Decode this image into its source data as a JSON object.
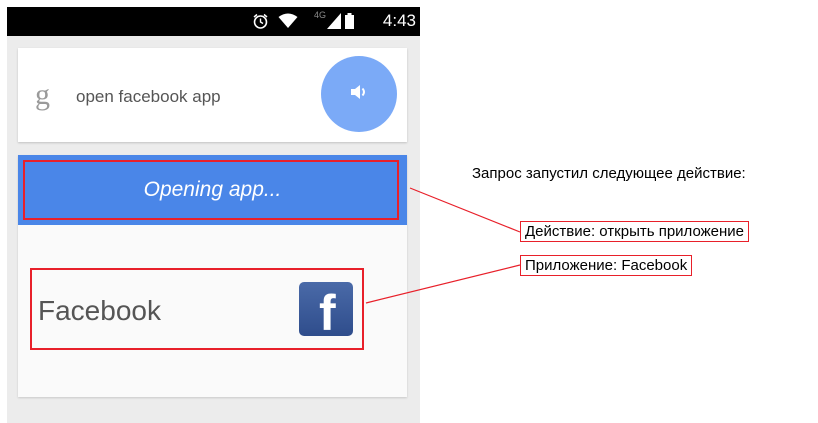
{
  "status_bar": {
    "network": "4G",
    "time": "4:43"
  },
  "search": {
    "query": "open facebook app",
    "google_logo": "g"
  },
  "action": {
    "status_text": "Opening app...",
    "app_name": "Facebook",
    "app_icon_letter": "f"
  },
  "annotations": {
    "heading": "Запрос запустил следующее действие:",
    "action_label": "Действие: открыть приложение",
    "app_label": "Приложение: Facebook"
  },
  "colors": {
    "accent_blue": "#4a86e8",
    "mic_blue": "#7baaf7",
    "highlight_red": "#e8202a",
    "facebook_blue": "#3b5998"
  },
  "icons": [
    "alarm-icon",
    "wifi-icon",
    "signal-icon",
    "battery-icon",
    "google-icon",
    "speaker-icon",
    "facebook-icon"
  ]
}
